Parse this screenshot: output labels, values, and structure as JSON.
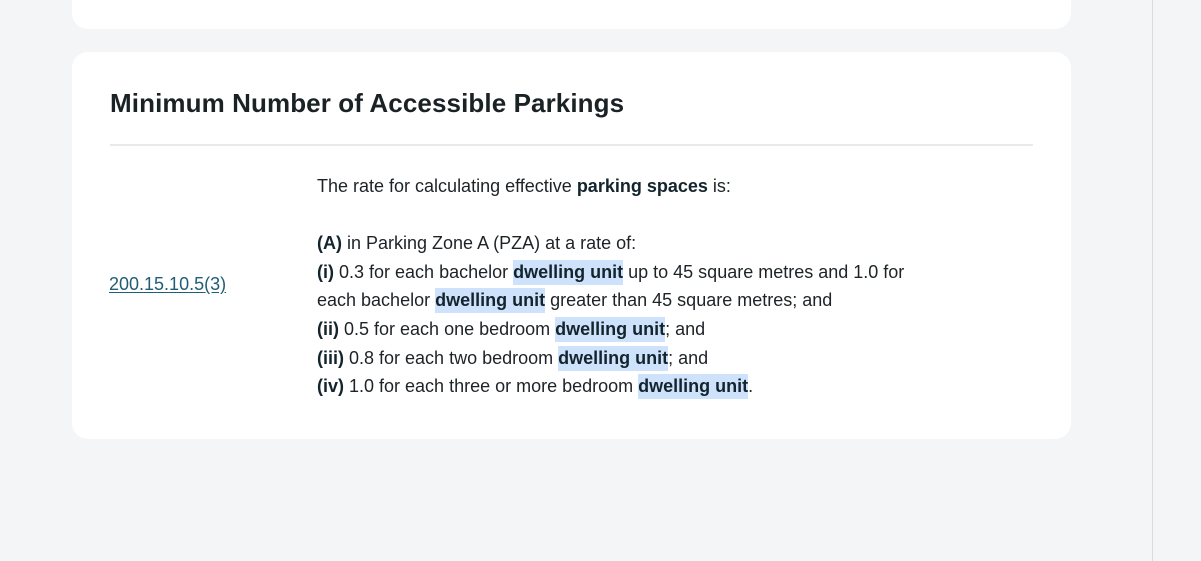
{
  "section": {
    "title": "Minimum Number of Accessible Parkings",
    "reference": "200.15.10.5(3)"
  },
  "rule": {
    "intro_text": "The rate for calculating effective ",
    "intro_term": "parking spaces",
    "intro_end": " is:",
    "a_label": "(A)",
    "a_text": " in Parking Zone A (PZA) at a rate of:",
    "i_label": "(i)",
    "i_text1": " 0.3 for each bachelor ",
    "term": "dwelling unit",
    "i_text2": " up to 45 square metres and 1.0 for",
    "i_text3": "each bachelor ",
    "i_text4": " greater than 45 square metres; and",
    "ii_label": "(ii)",
    "ii_text": " 0.5 for each one bedroom ",
    "ii_end": "; and",
    "iii_label": "(iii)",
    "iii_text": " 0.8 for each two bedroom ",
    "iii_end": "; and",
    "iv_label": "(iv)",
    "iv_text": " 1.0 for each three or more bedroom ",
    "iv_end": "."
  },
  "colors": {
    "background": "#f4f5f7",
    "card": "#ffffff",
    "link": "#1f5e75",
    "highlight": "#cfe2fb"
  }
}
